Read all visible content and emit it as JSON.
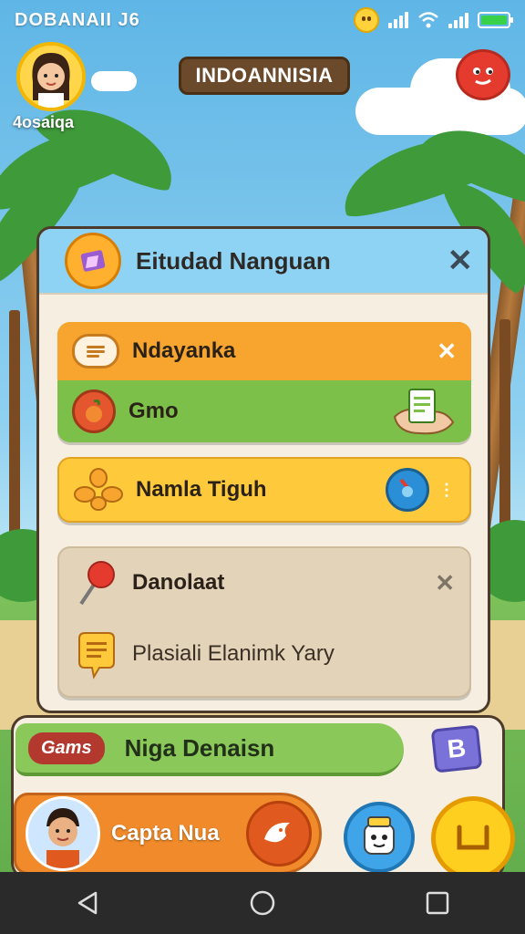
{
  "status": {
    "title": "DOBANAII J6"
  },
  "top": {
    "avatar_name": "4osaiqa",
    "app_title": "INDOANNISIA"
  },
  "panel": {
    "title": "Eitudad Nanguan",
    "close": "✕",
    "cards": [
      {
        "label": "Ndayanka",
        "close": "✕"
      },
      {
        "label": "Gmo"
      },
      {
        "label": "Namla Tiguh"
      },
      {
        "label": "Danolaat",
        "close": "✕"
      },
      {
        "label": "Plasiali Elanimk Yary"
      }
    ]
  },
  "bottom": {
    "games_pill": "Gams",
    "games_title": "Niga Denaisn",
    "badge_letter": "B",
    "player_name": "Capta Nua"
  },
  "colors": {
    "orange": "#f7a52e",
    "green": "#7cc04a",
    "yellow": "#ffc93c",
    "tan": "#e3d3b8"
  }
}
